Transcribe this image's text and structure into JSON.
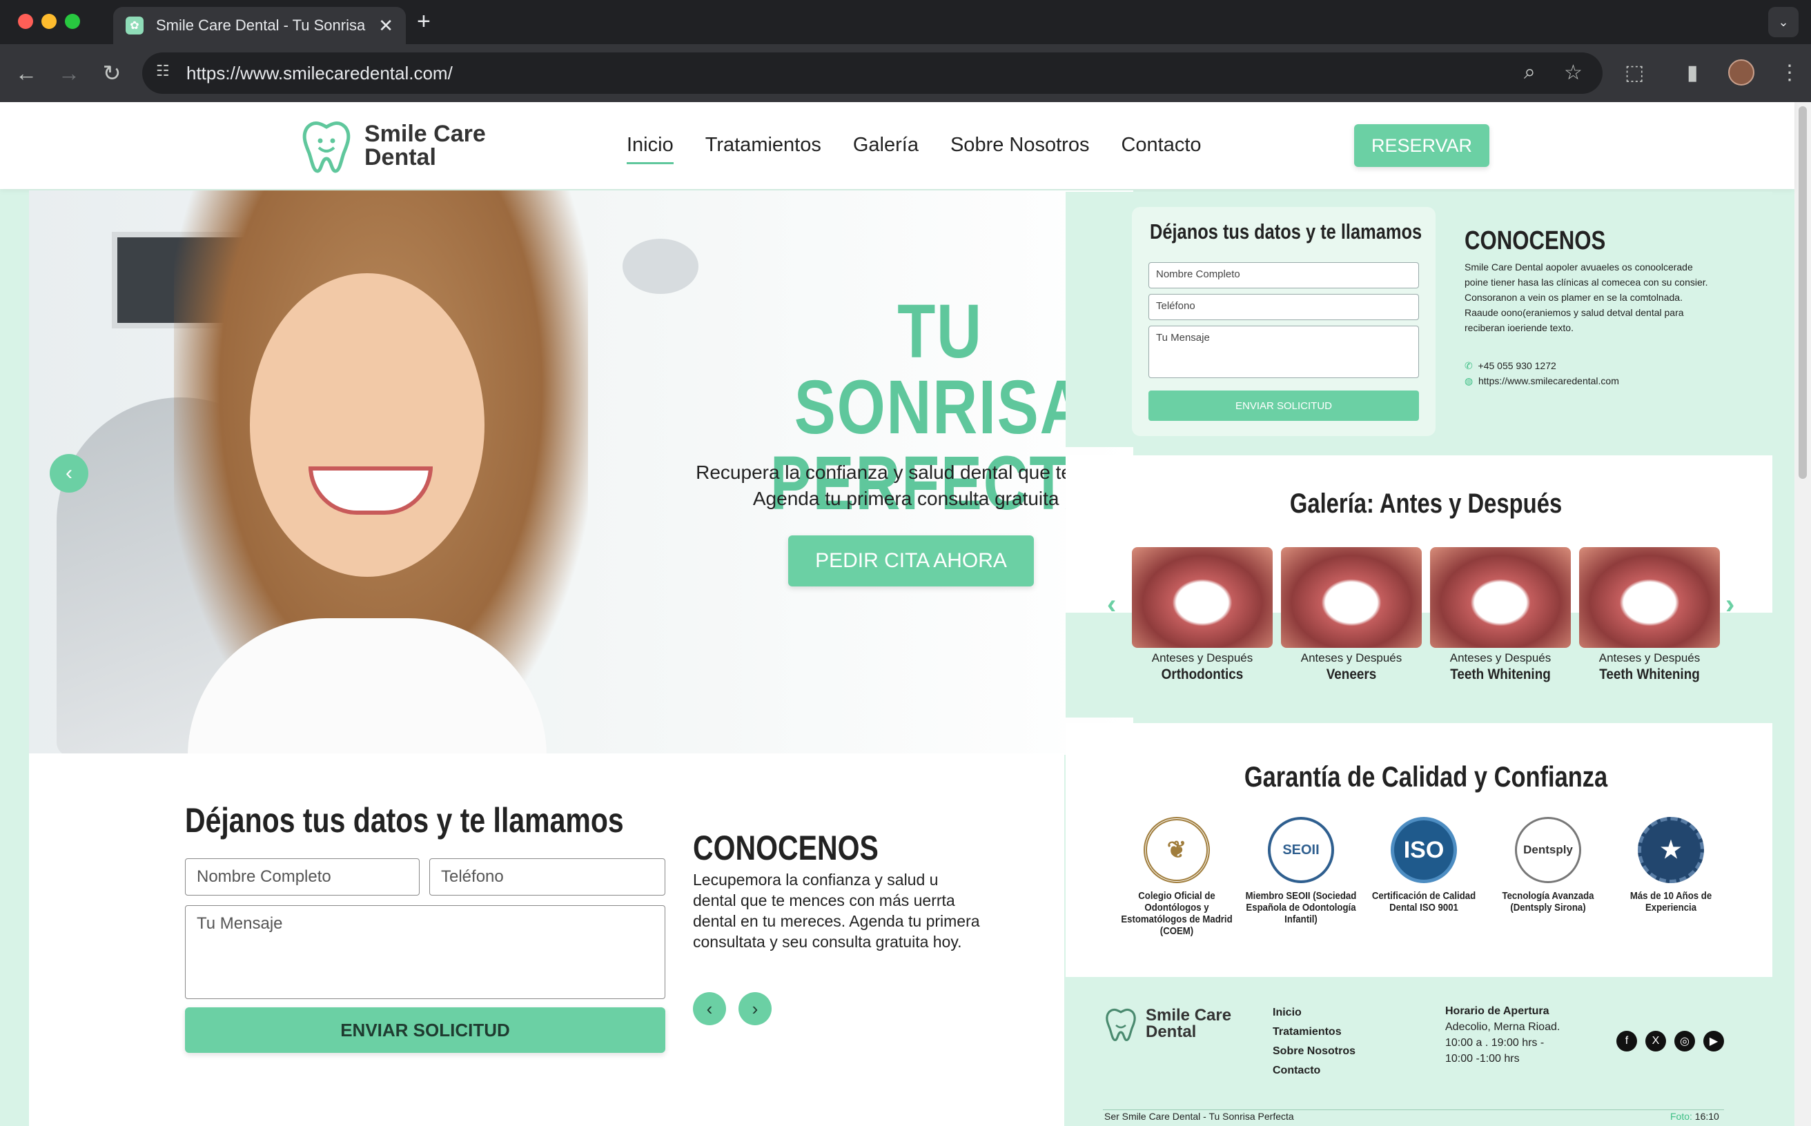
{
  "browser": {
    "tab_title": "Smile Care Dental - Tu Sonrisa",
    "tab_close": "✕",
    "new_tab": "+",
    "url": "https://www.smilecaredental.com/"
  },
  "header": {
    "logo_line1": "Smile Care",
    "logo_line2": "Dental",
    "nav": [
      "Inicio",
      "Tratamientos",
      "Galería",
      "Sobre Nosotros",
      "Contacto"
    ],
    "reserve_label": "RESERVAR"
  },
  "hero": {
    "title_line1": "TU SONRISA",
    "title_line2": "PERFECTA",
    "subtitle_line1": "Recupera la confianza y salud dental que te mereces.",
    "subtitle_line2": "Agenda tu primera consulta gratuita hoy.",
    "cta": "PEDIR CITA AHORA",
    "prev": "‹"
  },
  "side_form": {
    "title": "Déjanos tus datos y te llamamos",
    "name_placeholder": "Nombre Completo",
    "phone_placeholder": "Teléfono",
    "message_placeholder": "Tu Mensaje",
    "submit": "ENVIAR SOLICITUD"
  },
  "side_about": {
    "title": "CONOCENOS",
    "text": "Smile Care Dental aopoler avuaeles os conoolcerade poine tiener hasa las clínicas al comecea con su consier. Consoranon a vein os plamer en se la comtolnada. Raaude oono(eraniemos y salud detval dental para reciberan ioeriende texto.",
    "phone": "+45 055 930 1272",
    "website": "https://www.smilecaredental.com"
  },
  "gallery": {
    "title": "Galería: Antes y Después",
    "items": [
      {
        "caption": "Anteses y Después",
        "treatment": "Orthodontics"
      },
      {
        "caption": "Anteses y Después",
        "treatment": "Veneers"
      },
      {
        "caption": "Anteses y Después",
        "treatment": "Teeth Whitening"
      },
      {
        "caption": "Anteses y Después",
        "treatment": "Teeth Whitening"
      }
    ],
    "prev": "‹",
    "next": "›"
  },
  "lower_form": {
    "title": "Déjanos tus datos y te llamamos",
    "name_placeholder": "Nombre Completo",
    "phone_placeholder": "Teléfono",
    "message_placeholder": "Tu Mensaje",
    "submit": "ENVIAR SOLICITUD"
  },
  "lower_about": {
    "title": "CONOCENOS",
    "text": "Lecupemora la confianza y salud u dental que te mences con más uerrta dental en tu mereces. Agenda tu primera consultata y seu consulta gratuita hoy.",
    "prev": "‹",
    "next": "›"
  },
  "quality": {
    "title": "Garantía de Calidad y Confianza",
    "badges": [
      {
        "icon": "laurel-tooth-icon",
        "label": "Colegio Oficial de Odontólogos y Estomatólogos de Madrid (COEM)"
      },
      {
        "icon": "seoii-seal-icon",
        "glyph": "SEOII",
        "label": "Miembro SEOII (Sociedad Española de Odontología Infantil)"
      },
      {
        "icon": "iso-seal-icon",
        "glyph": "ISO",
        "label": "Certificación de Calidad Dental ISO 9001"
      },
      {
        "icon": "dentsply-logo-icon",
        "glyph": "Dentsply",
        "label": "Tecnología Avanzada (Dentsply Sirona)"
      },
      {
        "icon": "star-seal-icon",
        "glyph": "★",
        "label": "Más de 10 Años de Experiencia"
      }
    ]
  },
  "footer": {
    "logo_line1": "Smile Care",
    "logo_line2": "Dental",
    "links": [
      "Inicio",
      "Tratamientos",
      "Sobre Nosotros",
      "Contacto"
    ],
    "hours_title": "Horario de Apertura",
    "hours_line1": "Adecolio, Merna Rioad.",
    "hours_line2": "10:00 a . 19:00 hrs -",
    "hours_line3": "10:00 -1:00 hrs",
    "social": [
      "facebook-icon",
      "x-icon",
      "instagram-icon",
      "youtube-icon"
    ],
    "copyright": "Ser Smile Care Dental - Tu Sonrisa Perfecta",
    "time_label": "Foto:",
    "time_value": "16:10"
  },
  "colors": {
    "accent": "#6bd0a4",
    "accent_text": "#5fc79c",
    "mint_bg": "#d8f3e7"
  }
}
